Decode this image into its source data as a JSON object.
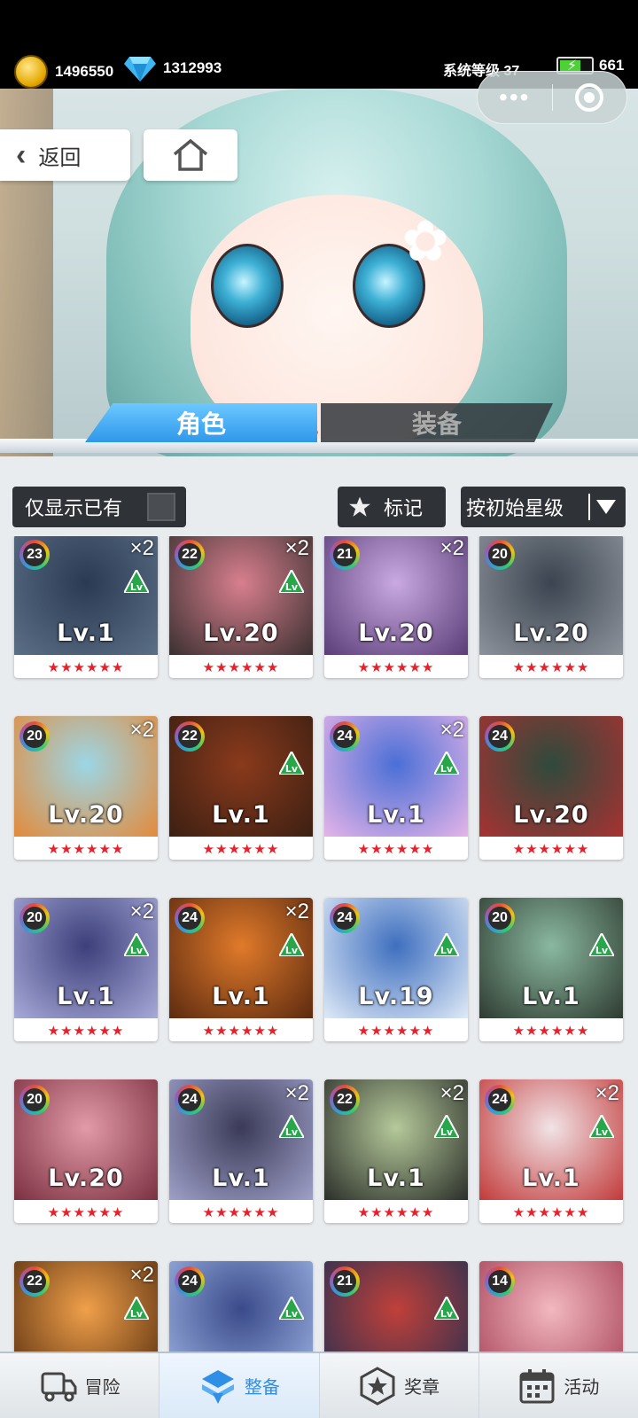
{
  "topbar": {
    "gold": "1496550",
    "diamonds": "1312993",
    "system_level_label": "系统等级",
    "system_level": "37",
    "energy": "661"
  },
  "hero": {
    "back_label": "返回"
  },
  "tabs": [
    {
      "label": "角色",
      "active": true
    },
    {
      "label": "装备",
      "active": false
    }
  ],
  "filters": {
    "owned_only": "仅显示已有",
    "mark": "标记",
    "sort": "按初始星级"
  },
  "cards": [
    {
      "badge": "23",
      "mult": "×2",
      "lv": "Lv.1",
      "up": true,
      "colors": [
        "#2a3a52",
        "#5b6f86"
      ]
    },
    {
      "badge": "22",
      "mult": "×2",
      "lv": "Lv.20",
      "up": true,
      "colors": [
        "#d87f8e",
        "#3a3030"
      ]
    },
    {
      "badge": "21",
      "mult": "×2",
      "lv": "Lv.20",
      "up": false,
      "colors": [
        "#c9a9e0",
        "#5a3d78"
      ]
    },
    {
      "badge": "20",
      "mult": "",
      "lv": "Lv.20",
      "up": false,
      "colors": [
        "#3b4450",
        "#8d939b"
      ]
    },
    {
      "badge": "20",
      "mult": "×2",
      "lv": "Lv.20",
      "up": false,
      "colors": [
        "#9cd6e6",
        "#e38a3a"
      ]
    },
    {
      "badge": "22",
      "mult": "",
      "lv": "Lv.1",
      "up": true,
      "colors": [
        "#8a3a1c",
        "#3b1f12"
      ]
    },
    {
      "badge": "24",
      "mult": "×2",
      "lv": "Lv.1",
      "up": true,
      "colors": [
        "#4a6fd6",
        "#e6b4e8"
      ]
    },
    {
      "badge": "24",
      "mult": "",
      "lv": "Lv.20",
      "up": false,
      "colors": [
        "#2f4a3c",
        "#a73232"
      ]
    },
    {
      "badge": "20",
      "mult": "×2",
      "lv": "Lv.1",
      "up": true,
      "colors": [
        "#3c3f7a",
        "#a7a9d8"
      ]
    },
    {
      "badge": "24",
      "mult": "×2",
      "lv": "Lv.1",
      "up": true,
      "colors": [
        "#e07a2a",
        "#5c2a10"
      ]
    },
    {
      "badge": "24",
      "mult": "",
      "lv": "Lv.19",
      "up": true,
      "colors": [
        "#3e6fbf",
        "#dfeaf7"
      ]
    },
    {
      "badge": "20",
      "mult": "",
      "lv": "Lv.1",
      "up": true,
      "colors": [
        "#8ab8a0",
        "#2e3b30"
      ]
    },
    {
      "badge": "20",
      "mult": "",
      "lv": "Lv.20",
      "up": false,
      "colors": [
        "#e39aa8",
        "#7a3040"
      ]
    },
    {
      "badge": "24",
      "mult": "×2",
      "lv": "Lv.1",
      "up": true,
      "colors": [
        "#3b3a58",
        "#9ea0c8"
      ]
    },
    {
      "badge": "22",
      "mult": "×2",
      "lv": "Lv.1",
      "up": true,
      "colors": [
        "#b5c99a",
        "#2b2f2a"
      ]
    },
    {
      "badge": "24",
      "mult": "×2",
      "lv": "Lv.1",
      "up": true,
      "colors": [
        "#f1e3e6",
        "#c23a3a"
      ]
    },
    {
      "badge": "22",
      "mult": "×2",
      "lv": "",
      "up": true,
      "colors": [
        "#f0a04a",
        "#5a3010"
      ]
    },
    {
      "badge": "24",
      "mult": "",
      "lv": "",
      "up": true,
      "colors": [
        "#3a4a8a",
        "#9ab0e0"
      ]
    },
    {
      "badge": "21",
      "mult": "",
      "lv": "",
      "up": true,
      "colors": [
        "#c0403a",
        "#2a3050"
      ]
    },
    {
      "badge": "14",
      "mult": "",
      "lv": "",
      "up": false,
      "colors": [
        "#f2b8c0",
        "#a8445a"
      ]
    }
  ],
  "nav": [
    {
      "label": "冒险",
      "icon": "truck-icon",
      "active": false
    },
    {
      "label": "整备",
      "icon": "gem-stack-icon",
      "active": true
    },
    {
      "label": "奖章",
      "icon": "star-medal-icon",
      "active": false
    },
    {
      "label": "活动",
      "icon": "calendar-icon",
      "active": false
    }
  ],
  "colors": {
    "accent": "#2f8fe6",
    "star": "#e8202a",
    "button_dark": "#2f3236"
  }
}
